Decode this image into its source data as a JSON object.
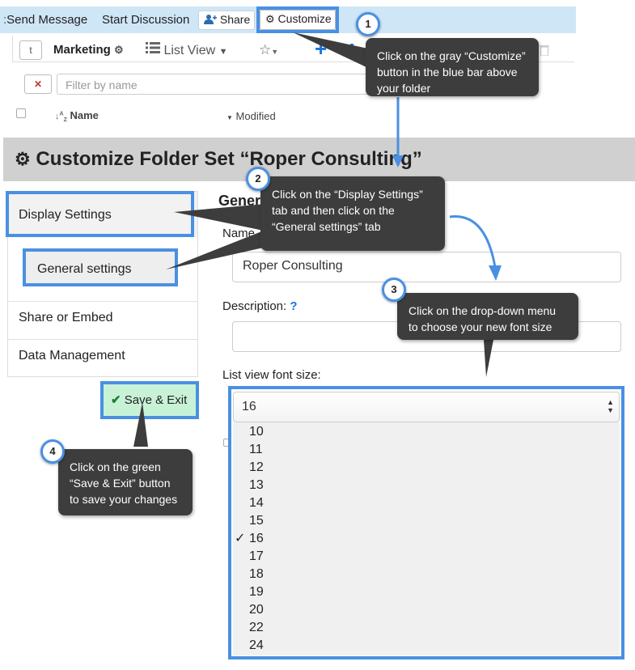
{
  "topbar": {
    "send_message": "Send Message",
    "start_discussion": "Start Discussion",
    "share": "Share",
    "customize": "Customize"
  },
  "folder": {
    "t_button": "t",
    "name": "Marketing",
    "view": "List View",
    "filter_placeholder": "Filter by name",
    "col_name": "Name",
    "col_modified": "Modified"
  },
  "page": {
    "title": "Customize Folder Set “Roper Consulting”"
  },
  "nav": {
    "items": [
      "Display Settings",
      "General settings",
      "Share or Embed",
      "Data Management"
    ]
  },
  "form": {
    "section_heading": "General settings",
    "name_label": "Name",
    "name_value": "Roper Consulting",
    "description_label": "Description:",
    "help": "?",
    "font_size_label": "List view font size:",
    "font_size_value": "16",
    "font_size_options": [
      "10",
      "11",
      "12",
      "13",
      "14",
      "15",
      "16",
      "17",
      "18",
      "19",
      "20",
      "22",
      "24"
    ],
    "selected_option": "16"
  },
  "save_exit": "Save & Exit",
  "tips": [
    {
      "num": "1",
      "text": "Click on the gray “Customize” button in the blue bar above your folder"
    },
    {
      "num": "2",
      "text": "Click on the “Display Settings” tab and then click on the “General settings” tab"
    },
    {
      "num": "3",
      "text": "Click on the drop-down menu to choose your new font size"
    },
    {
      "num": "4",
      "text": "Click on the green “Save & Exit” button to save your changes"
    }
  ],
  "colors": {
    "highlight": "#4a90e2",
    "topbar": "#cfe6f7",
    "banner": "#d0d0d0",
    "tooltip": "#3d3d3d",
    "save_button": "#c8f2d6",
    "add_icon": "#1a73d9"
  },
  "icons": {
    "share": "add-user-icon",
    "customize": "gears-icon",
    "settings": "gear-icon",
    "view": "list-icon",
    "favorite": "star-icon",
    "add": "plus-icon",
    "clear": "close-icon",
    "sort": "sort-az-icon",
    "save": "checkmark-icon",
    "select": "updown-caret-icon"
  }
}
